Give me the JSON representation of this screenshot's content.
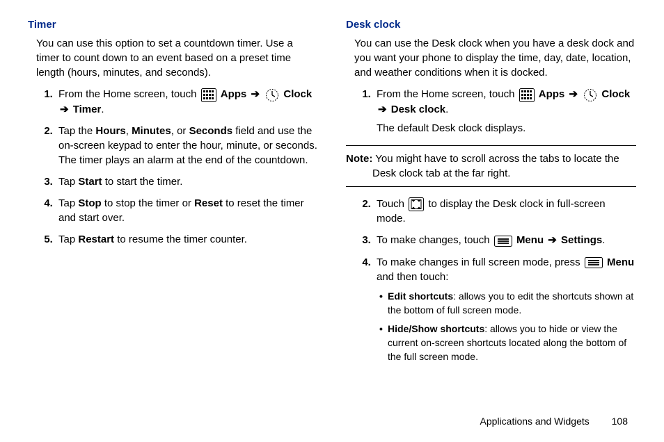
{
  "left": {
    "title": "Timer",
    "intro": "You can use this option to set a countdown timer. Use a timer to count down to an event based on a preset time length (hours, minutes, and seconds).",
    "step1_a": "From the Home screen, touch ",
    "apps": "Apps",
    "arrow": "➔",
    "clock": "Clock",
    "timer_label": "Timer",
    "step2_a": "Tap the ",
    "hours": "Hours",
    "comma1": ", ",
    "minutes": "Minutes",
    "comma2": ", or ",
    "seconds": "Seconds",
    "step2_b": " field and use the on-screen keypad to enter the hour, minute, or seconds. The timer plays an alarm at the end of the countdown.",
    "step3_a": "Tap ",
    "start": "Start",
    "step3_b": " to start the timer.",
    "step4_a": "Tap ",
    "stop": "Stop",
    "step4_b": " to stop the timer or ",
    "reset": "Reset",
    "step4_c": " to reset the timer and start over.",
    "step5_a": "Tap ",
    "restart": "Restart",
    "step5_b": " to resume the timer counter."
  },
  "right": {
    "title": "Desk clock",
    "intro": "You can use the Desk clock when you have a desk dock and you want your phone to display the time, day, date, location, and weather conditions when it is docked.",
    "step1_a": "From the Home screen, touch ",
    "apps": "Apps",
    "arrow": "➔",
    "clock": "Clock",
    "deskclock": "Desk clock",
    "period": ".",
    "step1_sub": "The default Desk clock displays.",
    "note_label": "Note:",
    "note_text": " You might have to scroll across the tabs to locate the Desk clock tab at the far right.",
    "step2_a": "Touch ",
    "step2_b": " to display the Desk clock in full-screen mode.",
    "step3_a": "To make changes, touch ",
    "menu": "Menu",
    "settings": "Settings",
    "step4_a": "To make changes in full screen mode, press ",
    "step4_b": " and then touch:",
    "bullet1_title": "Edit shortcuts",
    "bullet1_text": ": allows you to edit the shortcuts shown at the bottom of full screen mode.",
    "bullet2_title": "Hide/Show shortcuts",
    "bullet2_text": ": allows you to hide or view the current on-screen shortcuts located along the bottom of the full screen mode."
  },
  "footer": {
    "chapter": "Applications and Widgets",
    "page": "108"
  }
}
